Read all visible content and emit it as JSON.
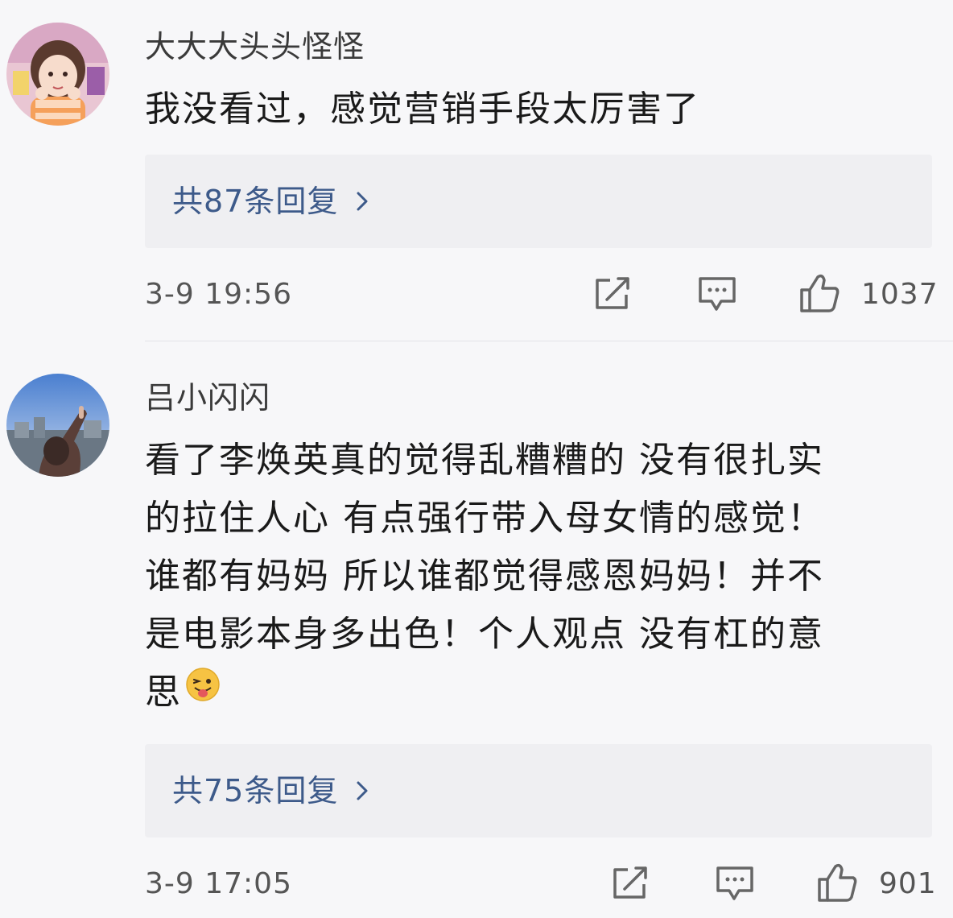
{
  "comments": [
    {
      "username": "大大大头头怪怪",
      "text_lines": [
        "我没看过，感觉营销手段太厉害了"
      ],
      "reply_label": "共87条回复",
      "timestamp": "3-9 19:56",
      "likes": "1037",
      "avatar_icon": "anime-girl-avatar"
    },
    {
      "username": "吕小闪闪",
      "text_lines": [
        "看了李焕英真的觉得乱糟糟的  没有很扎实",
        "的拉住人心  有点强行带入母女情的感觉！",
        "谁都有妈妈 所以谁都觉得感恩妈妈！并不",
        "是电影本身多出色！个人观点 没有杠的意",
        "思"
      ],
      "reply_label": "共75条回复",
      "timestamp": "3-9 17:05",
      "likes": "901",
      "avatar_icon": "sky-photo-avatar"
    }
  ],
  "icons": {
    "share": "share-icon",
    "comment": "comment-icon",
    "like": "thumbs-up-icon",
    "chevron": "chevron-right-icon",
    "emoji": "tongue-out-emoji-icon"
  },
  "colors": {
    "background": "#f7f7f9",
    "reply_box": "#efeff2",
    "reply_link": "#3d5a8a",
    "text": "#1a1a1a",
    "meta": "#555555"
  }
}
